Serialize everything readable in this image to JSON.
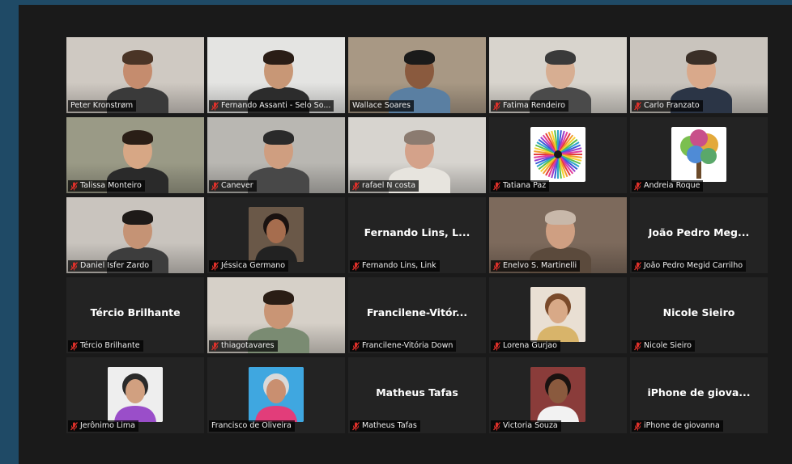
{
  "participants": [
    {
      "name": "Peter Kronstrøm",
      "tile_text": "",
      "muted": false,
      "video": true,
      "bg": "#cfc9c2",
      "skin": "#c58c6e",
      "shirt": "#3a3a3a",
      "hair": "#4a3426"
    },
    {
      "name": "Fernando Assanti - Selo So...",
      "tile_text": "",
      "muted": true,
      "video": true,
      "bg": "#e4e4e2",
      "skin": "#c89776",
      "shirt": "#2c2c2c",
      "hair": "#2a1d16"
    },
    {
      "name": "Wallace Soares",
      "tile_text": "",
      "muted": false,
      "video": true,
      "bg": "#a89884",
      "skin": "#8a5a3e",
      "shirt": "#5a7fa2",
      "hair": "#1a1a1a"
    },
    {
      "name": "Fatima Rendeiro",
      "tile_text": "",
      "muted": true,
      "video": true,
      "bg": "#d8d4cd",
      "skin": "#d7ae92",
      "shirt": "#4a4a4a",
      "hair": "#3a3a3a"
    },
    {
      "name": "Carlo Franzato",
      "tile_text": "",
      "muted": true,
      "video": true,
      "bg": "#c9c4bd",
      "skin": "#d9a98b",
      "shirt": "#2b3546",
      "hair": "#3a2f27"
    },
    {
      "name": "Talissa Monteiro",
      "tile_text": "",
      "muted": true,
      "video": true,
      "bg": "#9a9a86",
      "skin": "#d7a785",
      "shirt": "#2a2a2a",
      "hair": "#2a1e16"
    },
    {
      "name": "Canever",
      "tile_text": "",
      "muted": true,
      "video": true,
      "bg": "#b9b7b2",
      "skin": "#cf9e80",
      "shirt": "#484848",
      "hair": "#2a2a2a"
    },
    {
      "name": "rafael N costa",
      "tile_text": "",
      "muted": true,
      "video": true,
      "bg": "#d7d4cf",
      "skin": "#d4a28a",
      "shirt": "#e7e4de",
      "hair": "#8b7b70"
    },
    {
      "name": "Tatiana Paz",
      "tile_text": "",
      "muted": true,
      "video": false,
      "avatar": "burst",
      "bg": "#ffffff"
    },
    {
      "name": "Andreia Roque",
      "tile_text": "",
      "muted": true,
      "video": false,
      "avatar": "tree",
      "bg": "#ffffff"
    },
    {
      "name": "Daniel Isfer Zardo",
      "tile_text": "",
      "muted": true,
      "video": true,
      "bg": "#c9c4be",
      "skin": "#c59375",
      "shirt": "#3d3d3d",
      "hair": "#1e1a18"
    },
    {
      "name": "Jéssica Germano",
      "tile_text": "",
      "muted": true,
      "video": false,
      "avatar": "photo",
      "bg": "#6a5848",
      "skin": "#a66d4e",
      "hair": "#1a1210",
      "shirt": "#222222"
    },
    {
      "name": "Fernando Lins, Link",
      "tile_text": "Fernando Lins, L...",
      "muted": true,
      "video": false
    },
    {
      "name": "Enelvo S. Martinelli",
      "tile_text": "",
      "muted": true,
      "video": true,
      "bg": "#7d6a5c",
      "skin": "#cf9f82",
      "shirt": "#5b4a3c",
      "hair": "#c8b8aa"
    },
    {
      "name": "João Pedro Megid Carrilho",
      "tile_text": "João Pedro Meg...",
      "muted": true,
      "video": false
    },
    {
      "name": "Tércio Brilhante",
      "tile_text": "Tércio Brilhante",
      "muted": true,
      "video": false
    },
    {
      "name": "thiagotavares",
      "tile_text": "",
      "muted": true,
      "video": true,
      "bg": "#d6d0c8",
      "skin": "#c99575",
      "shirt": "#7a8b72",
      "hair": "#2a1d15"
    },
    {
      "name": "Francilene-Vitória Down",
      "tile_text": "Francilene-Vitór...",
      "muted": true,
      "video": false
    },
    {
      "name": "Lorena Gurjao",
      "tile_text": "",
      "muted": true,
      "video": false,
      "avatar": "photo",
      "bg": "#e9dfd3",
      "skin": "#d8a987",
      "hair": "#7a4a2a",
      "shirt": "#d8b46a"
    },
    {
      "name": "Nicole Sieiro",
      "tile_text": "Nicole Sieiro",
      "muted": true,
      "video": false
    },
    {
      "name": "Jerônimo Lima",
      "tile_text": "",
      "muted": true,
      "video": false,
      "avatar": "photo",
      "bg": "#eeeeee",
      "skin": "#d1a080",
      "hair": "#2a2a2a",
      "shirt": "#9a4ec9"
    },
    {
      "name": "Francisco de Oliveira",
      "tile_text": "",
      "muted": false,
      "video": false,
      "avatar": "photo",
      "bg": "#3fa7e0",
      "skin": "#c98f70",
      "hair": "#d9d9d9",
      "shirt": "#e23d7a"
    },
    {
      "name": "Matheus Tafas",
      "tile_text": "Matheus Tafas",
      "muted": true,
      "video": false
    },
    {
      "name": "Victoria Souza",
      "tile_text": "",
      "muted": true,
      "video": false,
      "avatar": "photo",
      "bg": "#8a3c3a",
      "skin": "#8a5a3e",
      "hair": "#1a1210",
      "shirt": "#f2f2f2"
    },
    {
      "name": "iPhone de giovanna",
      "tile_text": "iPhone de giova...",
      "muted": true,
      "video": false
    }
  ],
  "active_speaker_index": 2,
  "colors": {
    "active_border": "#b7d94a",
    "muted_icon": "#e0302a",
    "tile_bg": "#232323",
    "window_bg": "#1a1a1a",
    "outer_bg": "#1f4a66"
  }
}
